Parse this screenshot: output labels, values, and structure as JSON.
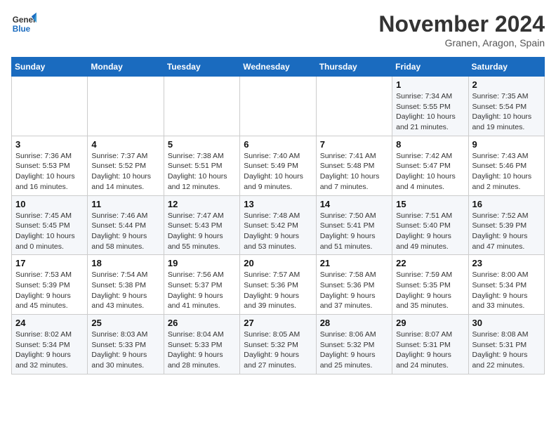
{
  "logo": {
    "line1": "General",
    "line2": "Blue"
  },
  "title": "November 2024",
  "subtitle": "Granen, Aragon, Spain",
  "weekdays": [
    "Sunday",
    "Monday",
    "Tuesday",
    "Wednesday",
    "Thursday",
    "Friday",
    "Saturday"
  ],
  "weeks": [
    [
      {
        "day": "",
        "info": ""
      },
      {
        "day": "",
        "info": ""
      },
      {
        "day": "",
        "info": ""
      },
      {
        "day": "",
        "info": ""
      },
      {
        "day": "",
        "info": ""
      },
      {
        "day": "1",
        "info": "Sunrise: 7:34 AM\nSunset: 5:55 PM\nDaylight: 10 hours and 21 minutes."
      },
      {
        "day": "2",
        "info": "Sunrise: 7:35 AM\nSunset: 5:54 PM\nDaylight: 10 hours and 19 minutes."
      }
    ],
    [
      {
        "day": "3",
        "info": "Sunrise: 7:36 AM\nSunset: 5:53 PM\nDaylight: 10 hours and 16 minutes."
      },
      {
        "day": "4",
        "info": "Sunrise: 7:37 AM\nSunset: 5:52 PM\nDaylight: 10 hours and 14 minutes."
      },
      {
        "day": "5",
        "info": "Sunrise: 7:38 AM\nSunset: 5:51 PM\nDaylight: 10 hours and 12 minutes."
      },
      {
        "day": "6",
        "info": "Sunrise: 7:40 AM\nSunset: 5:49 PM\nDaylight: 10 hours and 9 minutes."
      },
      {
        "day": "7",
        "info": "Sunrise: 7:41 AM\nSunset: 5:48 PM\nDaylight: 10 hours and 7 minutes."
      },
      {
        "day": "8",
        "info": "Sunrise: 7:42 AM\nSunset: 5:47 PM\nDaylight: 10 hours and 4 minutes."
      },
      {
        "day": "9",
        "info": "Sunrise: 7:43 AM\nSunset: 5:46 PM\nDaylight: 10 hours and 2 minutes."
      }
    ],
    [
      {
        "day": "10",
        "info": "Sunrise: 7:45 AM\nSunset: 5:45 PM\nDaylight: 10 hours and 0 minutes."
      },
      {
        "day": "11",
        "info": "Sunrise: 7:46 AM\nSunset: 5:44 PM\nDaylight: 9 hours and 58 minutes."
      },
      {
        "day": "12",
        "info": "Sunrise: 7:47 AM\nSunset: 5:43 PM\nDaylight: 9 hours and 55 minutes."
      },
      {
        "day": "13",
        "info": "Sunrise: 7:48 AM\nSunset: 5:42 PM\nDaylight: 9 hours and 53 minutes."
      },
      {
        "day": "14",
        "info": "Sunrise: 7:50 AM\nSunset: 5:41 PM\nDaylight: 9 hours and 51 minutes."
      },
      {
        "day": "15",
        "info": "Sunrise: 7:51 AM\nSunset: 5:40 PM\nDaylight: 9 hours and 49 minutes."
      },
      {
        "day": "16",
        "info": "Sunrise: 7:52 AM\nSunset: 5:39 PM\nDaylight: 9 hours and 47 minutes."
      }
    ],
    [
      {
        "day": "17",
        "info": "Sunrise: 7:53 AM\nSunset: 5:39 PM\nDaylight: 9 hours and 45 minutes."
      },
      {
        "day": "18",
        "info": "Sunrise: 7:54 AM\nSunset: 5:38 PM\nDaylight: 9 hours and 43 minutes."
      },
      {
        "day": "19",
        "info": "Sunrise: 7:56 AM\nSunset: 5:37 PM\nDaylight: 9 hours and 41 minutes."
      },
      {
        "day": "20",
        "info": "Sunrise: 7:57 AM\nSunset: 5:36 PM\nDaylight: 9 hours and 39 minutes."
      },
      {
        "day": "21",
        "info": "Sunrise: 7:58 AM\nSunset: 5:36 PM\nDaylight: 9 hours and 37 minutes."
      },
      {
        "day": "22",
        "info": "Sunrise: 7:59 AM\nSunset: 5:35 PM\nDaylight: 9 hours and 35 minutes."
      },
      {
        "day": "23",
        "info": "Sunrise: 8:00 AM\nSunset: 5:34 PM\nDaylight: 9 hours and 33 minutes."
      }
    ],
    [
      {
        "day": "24",
        "info": "Sunrise: 8:02 AM\nSunset: 5:34 PM\nDaylight: 9 hours and 32 minutes."
      },
      {
        "day": "25",
        "info": "Sunrise: 8:03 AM\nSunset: 5:33 PM\nDaylight: 9 hours and 30 minutes."
      },
      {
        "day": "26",
        "info": "Sunrise: 8:04 AM\nSunset: 5:33 PM\nDaylight: 9 hours and 28 minutes."
      },
      {
        "day": "27",
        "info": "Sunrise: 8:05 AM\nSunset: 5:32 PM\nDaylight: 9 hours and 27 minutes."
      },
      {
        "day": "28",
        "info": "Sunrise: 8:06 AM\nSunset: 5:32 PM\nDaylight: 9 hours and 25 minutes."
      },
      {
        "day": "29",
        "info": "Sunrise: 8:07 AM\nSunset: 5:31 PM\nDaylight: 9 hours and 24 minutes."
      },
      {
        "day": "30",
        "info": "Sunrise: 8:08 AM\nSunset: 5:31 PM\nDaylight: 9 hours and 22 minutes."
      }
    ]
  ]
}
